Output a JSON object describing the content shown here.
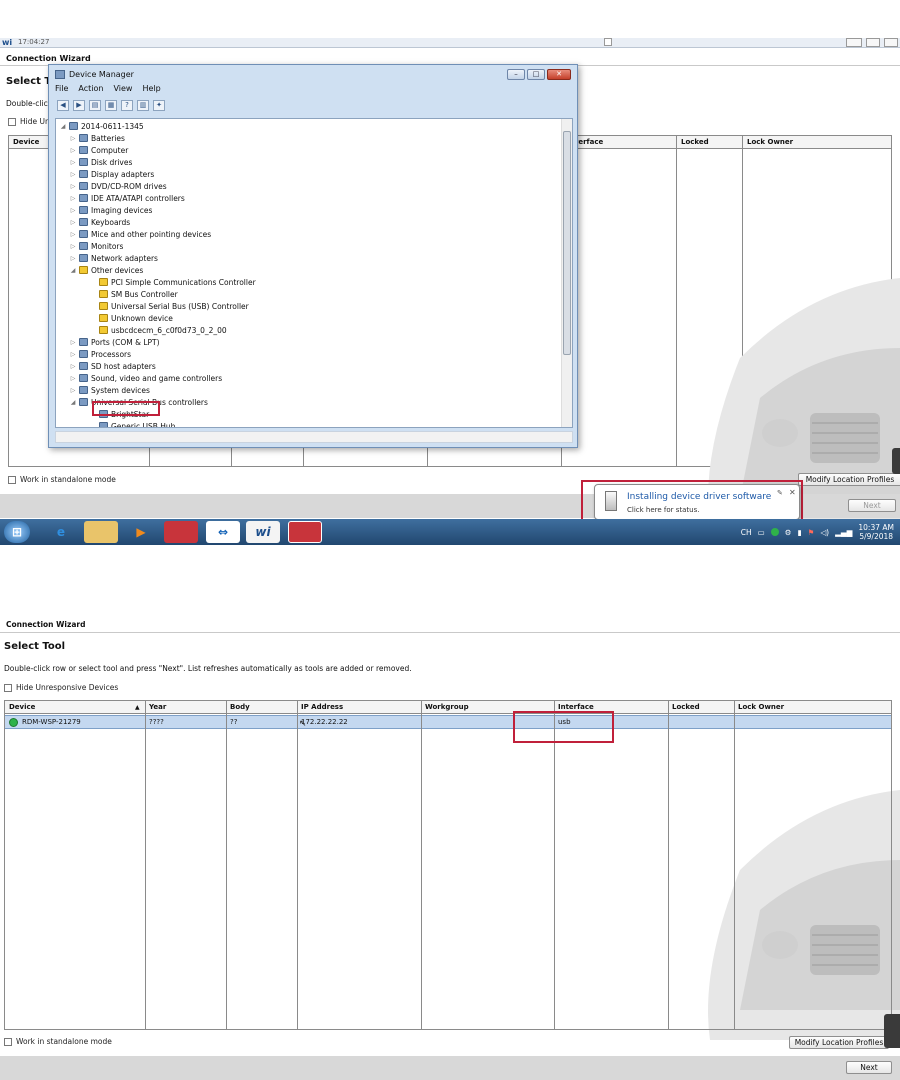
{
  "top_screen": {
    "topbar": {
      "app_logo": "wi",
      "time": "17:04:27"
    },
    "wizard_title": "Connection Wizard",
    "section_title_partial": "Select T",
    "desc_partial": "Double-clic",
    "hide_checkbox_partial": "Hide Un",
    "grid_headers": [
      "Device",
      "Interface",
      "Locked",
      "Lock Owner"
    ],
    "interface_header_partial": "terface",
    "standalone_label": "Work in standalone mode",
    "modify_button": "Modify Location Profiles",
    "next_button": "Next",
    "device_manager": {
      "title": "Device Manager",
      "menu": [
        "File",
        "Action",
        "View",
        "Help"
      ],
      "toolbar_icons": [
        "back-icon",
        "forward-icon",
        "properties-icon",
        "help-icon",
        "scan-icon"
      ],
      "root": "2014-0611-1345",
      "tree": [
        {
          "label": "Batteries",
          "level": 1,
          "icon": "dev"
        },
        {
          "label": "Computer",
          "level": 1,
          "icon": "dev"
        },
        {
          "label": "Disk drives",
          "level": 1,
          "icon": "dev"
        },
        {
          "label": "Display adapters",
          "level": 1,
          "icon": "dev"
        },
        {
          "label": "DVD/CD-ROM drives",
          "level": 1,
          "icon": "dev"
        },
        {
          "label": "IDE ATA/ATAPI controllers",
          "level": 1,
          "icon": "dev"
        },
        {
          "label": "Imaging devices",
          "level": 1,
          "icon": "dev"
        },
        {
          "label": "Keyboards",
          "level": 1,
          "icon": "dev"
        },
        {
          "label": "Mice and other pointing devices",
          "level": 1,
          "icon": "dev"
        },
        {
          "label": "Monitors",
          "level": 1,
          "icon": "dev"
        },
        {
          "label": "Network adapters",
          "level": 1,
          "icon": "dev"
        },
        {
          "label": "Other devices",
          "level": 1,
          "icon": "warn"
        },
        {
          "label": "PCI Simple Communications Controller",
          "level": 2,
          "icon": "warn"
        },
        {
          "label": "SM Bus Controller",
          "level": 2,
          "icon": "warn"
        },
        {
          "label": "Universal Serial Bus (USB) Controller",
          "level": 2,
          "icon": "warn"
        },
        {
          "label": "Unknown device",
          "level": 2,
          "icon": "warn"
        },
        {
          "label": "usbcdcecm_6_c0f0d73_0_2_00",
          "level": 2,
          "icon": "warn"
        },
        {
          "label": "Ports (COM & LPT)",
          "level": 1,
          "icon": "dev"
        },
        {
          "label": "Processors",
          "level": 1,
          "icon": "dev"
        },
        {
          "label": "SD host adapters",
          "level": 1,
          "icon": "dev"
        },
        {
          "label": "Sound, video and game controllers",
          "level": 1,
          "icon": "dev"
        },
        {
          "label": "System devices",
          "level": 1,
          "icon": "dev"
        },
        {
          "label": "Universal Serial Bus controllers",
          "level": 1,
          "icon": "dev"
        },
        {
          "label": "BrightStar",
          "level": 2,
          "icon": "dev"
        },
        {
          "label": "Generic USB Hub",
          "level": 2,
          "icon": "dev"
        }
      ]
    },
    "balloon": {
      "title": "Installing device driver software",
      "subtitle": "Click here for status."
    },
    "taskbar": {
      "apps": [
        "start-orb",
        "ie-icon",
        "explorer-icon",
        "media-player-icon",
        "toolbox-icon",
        "teamviewer-icon",
        "wi-icon",
        "toolbox-icon-2"
      ],
      "wi_label": "wi",
      "lang": "CH",
      "clock_time": "10:37 AM",
      "clock_date": "5/9/2018"
    }
  },
  "bottom_screen": {
    "wizard_title": "Connection Wizard",
    "section_title": "Select Tool",
    "description": "Double-click row or select tool and press \"Next\".  List refreshes automatically as tools are added or removed.",
    "hide_checkbox": "Hide Unresponsive Devices",
    "columns": [
      "Device",
      "Year",
      "Body",
      "IP Address",
      "Workgroup",
      "Interface",
      "Locked",
      "Lock Owner"
    ],
    "sort_indicator": "▲",
    "rows": [
      {
        "device": "RDM-WSP-21279",
        "year": "????",
        "body": "??",
        "ip": "172.22.22.22",
        "workgroup": "",
        "interface": "usb",
        "locked": "",
        "lock_owner": "",
        "status_color": "#2fb24a"
      }
    ],
    "standalone_label": "Work in standalone mode",
    "modify_button": "Modify Location Profiles",
    "next_button": "Next"
  },
  "colors": {
    "highlight_red": "#c0203a",
    "selection_blue": "#c4d8f0",
    "status_green": "#2fb24a"
  }
}
